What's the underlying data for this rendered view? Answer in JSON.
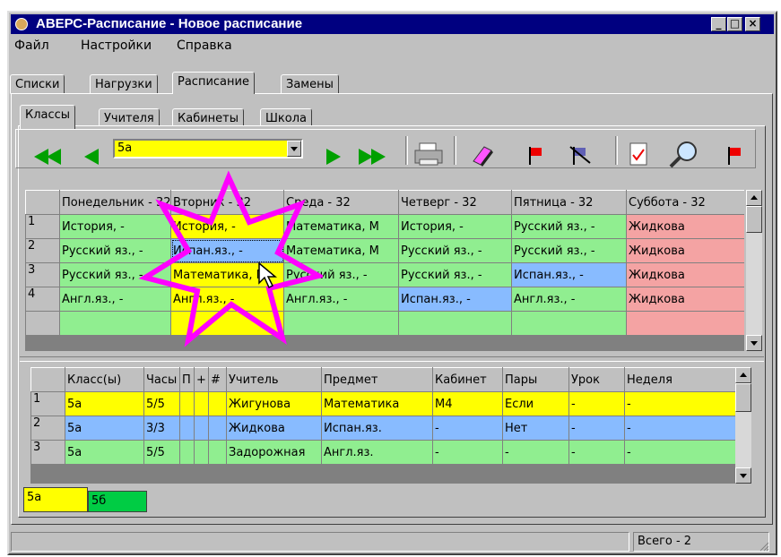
{
  "window": {
    "title": "АВЕРС-Расписание - Новое расписание",
    "min_label": "_",
    "max_label": "□",
    "close_label": "×"
  },
  "menu": [
    {
      "label": "Файл"
    },
    {
      "label": "Настройки"
    },
    {
      "label": "Справка"
    }
  ],
  "main_tabs": [
    {
      "label": "Списки"
    },
    {
      "label": "Нагрузки"
    },
    {
      "label": "Расписание",
      "active": true
    },
    {
      "label": "Замены"
    }
  ],
  "sub_tabs": [
    {
      "label": "Классы",
      "active": true
    },
    {
      "label": "Учителя"
    },
    {
      "label": "Кабинеты"
    },
    {
      "label": "Школа"
    }
  ],
  "toolbar": {
    "class_select_value": "5а"
  },
  "schedule": {
    "columns": [
      "Понедельник - 32",
      "Вторник - 32",
      "Среда - 32",
      "Четверг - 32",
      "Пятница - 32",
      "Суббота - 32"
    ],
    "rows": [
      {
        "num": "1",
        "cells": [
          "История, -",
          "История, -",
          "Математика, М",
          "История, -",
          "Русский яз., -",
          "Жидкова"
        ]
      },
      {
        "num": "2",
        "cells": [
          "Русский яз., -",
          "Испан.яз., -",
          "Математика, М",
          "Русский яз., -",
          "Русский яз., -",
          "Жидкова"
        ]
      },
      {
        "num": "3",
        "cells": [
          "Русский яз., -",
          "Математика, М",
          "Русский яз., -",
          "Русский яз., -",
          "Испан.яз., -",
          "Жидкова"
        ]
      },
      {
        "num": "4",
        "cells": [
          "Англ.яз., -",
          "Англ.яз., -",
          "Англ.яз., -",
          "Испан.яз., -",
          "Англ.яз., -",
          "Жидкова"
        ]
      }
    ]
  },
  "load": {
    "columns": [
      "Класс(ы)",
      "Часы",
      "П",
      "+",
      "#",
      "Учитель",
      "Предмет",
      "Кабинет",
      "Пары",
      "Урок",
      "Неделя"
    ],
    "rows": [
      {
        "num": "1",
        "cells": [
          "5а",
          "5/5",
          "",
          "",
          "",
          "Жигунова",
          "Математика",
          "М4",
          "Если",
          "-",
          "-"
        ]
      },
      {
        "num": "2",
        "cells": [
          "5а",
          "3/3",
          "",
          "",
          "",
          "Жидкова",
          "Испан.яз.",
          "-",
          "Нет",
          "-",
          "-"
        ]
      },
      {
        "num": "3",
        "cells": [
          "5а",
          "5/5",
          "",
          "",
          "",
          "Задорожная",
          "Англ.яз.",
          "-",
          "-",
          "-",
          "-"
        ]
      }
    ]
  },
  "class_tabs": [
    {
      "label": "5а"
    },
    {
      "label": "5б"
    }
  ],
  "status": {
    "total": "Всего - 2"
  }
}
